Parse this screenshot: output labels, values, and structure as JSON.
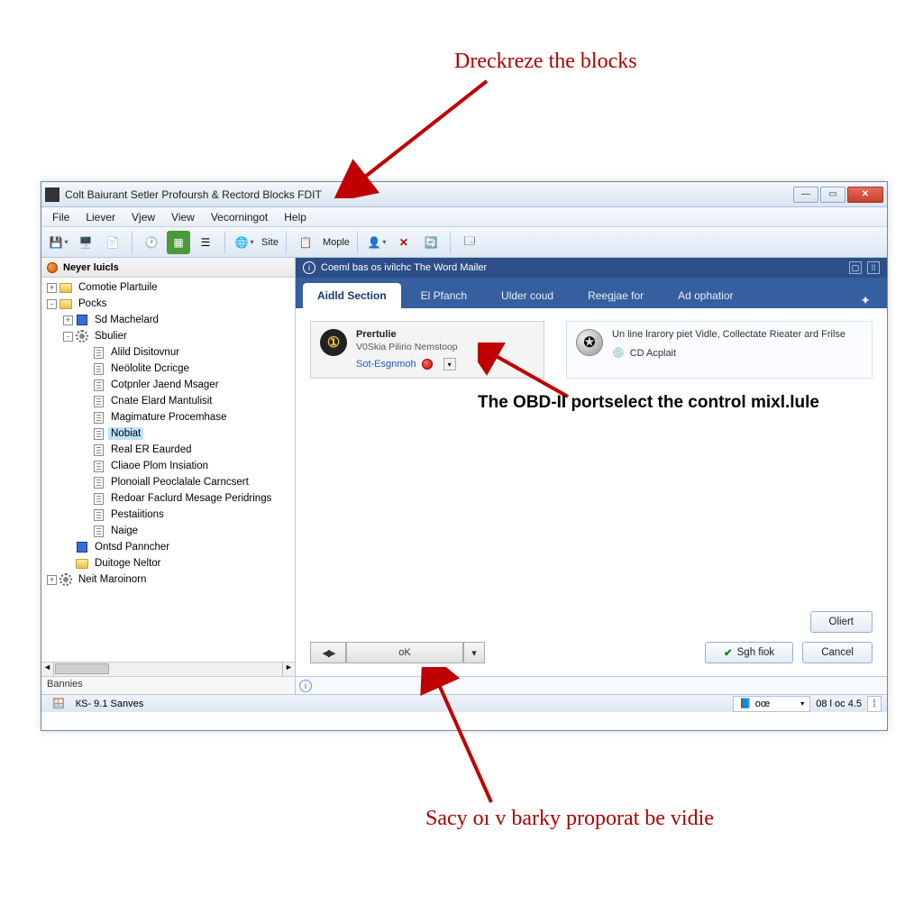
{
  "annotations": {
    "top": "Dreckreze the blocks",
    "middle": "The OBD-II portselect the control mixl.lule",
    "bottom": "Sacy oı v barky proporat be vidie"
  },
  "window": {
    "title": "Colt Baiurant Setler Profoursh & Rectord Blocks FDIT"
  },
  "menu": {
    "items": [
      "File",
      "Liever",
      "Vjew",
      "View",
      "Vecorningot",
      "Help"
    ]
  },
  "toolbar": {
    "site_label": "Site",
    "mople_label": "Mople"
  },
  "sidebar": {
    "header": "Neyer luicls",
    "footer": "Bannies",
    "items": [
      {
        "depth": 0,
        "exp": "+",
        "icon": "folder",
        "label": "Comotie Plartuile"
      },
      {
        "depth": 0,
        "exp": "-",
        "icon": "folder",
        "label": "Pocks"
      },
      {
        "depth": 1,
        "exp": "+",
        "icon": "blue",
        "label": "Sd Machelard"
      },
      {
        "depth": 1,
        "exp": "-",
        "icon": "gear",
        "label": "Sbulier"
      },
      {
        "depth": 2,
        "exp": "",
        "icon": "page",
        "label": "Alild Disitovnur"
      },
      {
        "depth": 2,
        "exp": "",
        "icon": "page",
        "label": "Neölolite Dcricge"
      },
      {
        "depth": 2,
        "exp": "",
        "icon": "page",
        "label": "Cotpnler Jaend Msager"
      },
      {
        "depth": 2,
        "exp": "",
        "icon": "page",
        "label": "Cnate Elard Mantulisit"
      },
      {
        "depth": 2,
        "exp": "",
        "icon": "page",
        "label": "Magimature Procemhase"
      },
      {
        "depth": 2,
        "exp": "",
        "icon": "page",
        "label": "Nobiat",
        "sel": true
      },
      {
        "depth": 2,
        "exp": "",
        "icon": "page",
        "label": "Real ER Eaurded"
      },
      {
        "depth": 2,
        "exp": "",
        "icon": "page",
        "label": "Cliaoe Plom Insiation"
      },
      {
        "depth": 2,
        "exp": "",
        "icon": "page",
        "label": "Plonoiall Peoclalale Carncsert"
      },
      {
        "depth": 2,
        "exp": "",
        "icon": "page",
        "label": "Redoar Faclurd Mesage Peridrings"
      },
      {
        "depth": 2,
        "exp": "",
        "icon": "page",
        "label": "Pestaiitions"
      },
      {
        "depth": 2,
        "exp": "",
        "icon": "page",
        "label": "Naige"
      },
      {
        "depth": 1,
        "exp": "",
        "icon": "blue",
        "label": "Ontsd Panncher"
      },
      {
        "depth": 1,
        "exp": "",
        "icon": "folder",
        "label": "Duitoge Neltor"
      },
      {
        "depth": 0,
        "exp": "+",
        "icon": "gear",
        "label": "Neit Maroinorn"
      }
    ]
  },
  "content": {
    "header": "Coeml bas os ivilchc The Word Mailer",
    "tabs": [
      "Aidld Section",
      "El Pfanch",
      "Ulder coud",
      "Reegjae for",
      "Ad ophatior"
    ],
    "card_left": {
      "title": "Prertulie",
      "sub": "V0Skia Pilirio Nemstoop",
      "link": "Sot-Esgnmoh"
    },
    "card_right": {
      "title": "Un line lrarory piet Vidle, Collectate Rieater ard Frilse",
      "sub": "CD Acplait"
    },
    "nav_center": "oK",
    "client_btn": "Oliert",
    "ok_btn": "Sgh fiok",
    "cancel_btn": "Cancel"
  },
  "statusbar": {
    "left": "КS- 9.1 Sanves",
    "mid": "oœ",
    "right": "08 l oc 4.5"
  }
}
